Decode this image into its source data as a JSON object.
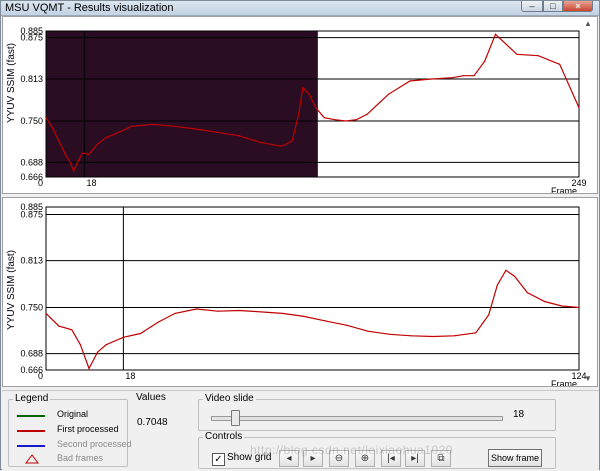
{
  "window": {
    "title": "MSU VQMT - Results visualization",
    "min_glyph": "–",
    "max_glyph": "□",
    "close_glyph": "×"
  },
  "top_chart": {
    "ylabel": "YYUV SSIM (fast)",
    "yticks": [
      "0.885",
      "0.875",
      "0.813",
      "0.750",
      "0.688",
      "0.666"
    ],
    "x_start": "0",
    "x_cursor": "18",
    "x_end": "249",
    "xlabel": "Frame",
    "processed_region_color": "#2a0d22"
  },
  "bottom_chart": {
    "ylabel": "YYUV SSIM (fast)",
    "yticks": [
      "0.885",
      "0.875",
      "0.813",
      "0.750",
      "0.688",
      "0.666"
    ],
    "x_start": "0",
    "x_cursor": "18",
    "x_end": "124",
    "xlabel": "Frame"
  },
  "chart_data": [
    {
      "type": "line",
      "ylabel": "YYUV SSIM (fast)",
      "xlabel": "Frame",
      "xlim": [
        0,
        249
      ],
      "ylim": [
        0.666,
        0.885
      ],
      "yticks": [
        0.666,
        0.688,
        0.75,
        0.813,
        0.875,
        0.885
      ],
      "cursor_frame": 18,
      "grid": true,
      "series": [
        {
          "name": "First processed",
          "color": "#c00000",
          "x": [
            0,
            3,
            6,
            9,
            11,
            13,
            15,
            17,
            20,
            24,
            28,
            32,
            40,
            50,
            60,
            70,
            80,
            90,
            100,
            110,
            115,
            118,
            120,
            123,
            126,
            130,
            135,
            140,
            145,
            150,
            160,
            170,
            180,
            190,
            195,
            200,
            205,
            210,
            220,
            230,
            240,
            249
          ],
          "y": [
            0.755,
            0.74,
            0.72,
            0.7,
            0.69,
            0.675,
            0.69,
            0.702,
            0.7,
            0.715,
            0.725,
            0.73,
            0.742,
            0.745,
            0.742,
            0.738,
            0.733,
            0.728,
            0.718,
            0.712,
            0.72,
            0.76,
            0.8,
            0.79,
            0.77,
            0.755,
            0.752,
            0.75,
            0.752,
            0.76,
            0.79,
            0.81,
            0.813,
            0.815,
            0.818,
            0.818,
            0.84,
            0.88,
            0.85,
            0.848,
            0.835,
            0.77
          ]
        }
      ]
    },
    {
      "type": "line",
      "ylabel": "YYUV SSIM (fast)",
      "xlabel": "Frame",
      "xlim": [
        0,
        124
      ],
      "ylim": [
        0.666,
        0.885
      ],
      "yticks": [
        0.666,
        0.688,
        0.75,
        0.813,
        0.875,
        0.885
      ],
      "cursor_frame": 18,
      "grid": true,
      "series": [
        {
          "name": "First processed",
          "color": "#c00000",
          "x": [
            0,
            3,
            6,
            8,
            10,
            12,
            14,
            16,
            18,
            22,
            26,
            30,
            35,
            40,
            45,
            50,
            55,
            60,
            65,
            70,
            75,
            80,
            85,
            90,
            95,
            100,
            103,
            105,
            107,
            109,
            112,
            116,
            120,
            124
          ],
          "y": [
            0.742,
            0.725,
            0.72,
            0.7,
            0.668,
            0.69,
            0.7,
            0.705,
            0.71,
            0.715,
            0.73,
            0.742,
            0.748,
            0.745,
            0.746,
            0.744,
            0.742,
            0.738,
            0.732,
            0.726,
            0.718,
            0.714,
            0.712,
            0.711,
            0.712,
            0.716,
            0.74,
            0.78,
            0.8,
            0.792,
            0.77,
            0.758,
            0.752,
            0.75
          ]
        }
      ]
    }
  ],
  "legend": {
    "title": "Legend",
    "items": [
      {
        "label": "Original",
        "color": "#006400",
        "marker": "line"
      },
      {
        "label": "First processed",
        "color": "#c00000",
        "marker": "line"
      },
      {
        "label": "Second processed",
        "color": "#1a1acc",
        "marker": "line"
      },
      {
        "label": "Bad frames",
        "color": "#c00000",
        "marker": "triangle-icon"
      }
    ]
  },
  "values": {
    "title": "Values",
    "value": "0.7048"
  },
  "video_slide": {
    "title": "Video slide",
    "value": "18",
    "position_fraction": 0.08
  },
  "controls": {
    "title": "Controls",
    "show_grid_label": "Show grid",
    "show_grid_checked": "✓",
    "buttons": [
      {
        "name": "prev-frame-icon",
        "glyph": "◂"
      },
      {
        "name": "next-frame-icon",
        "glyph": "▸"
      },
      {
        "name": "zoom-out-icon",
        "glyph": "🔍"
      },
      {
        "name": "zoom-in-icon",
        "glyph": "🔍"
      },
      {
        "name": "go-first-icon",
        "glyph": "|◂"
      },
      {
        "name": "go-last-icon",
        "glyph": "▸|"
      },
      {
        "name": "copy-icon",
        "glyph": "⧉"
      }
    ],
    "show_frame_label": "Show frame"
  },
  "watermark": "http://blog.csdn.net/leixiaohua1020"
}
